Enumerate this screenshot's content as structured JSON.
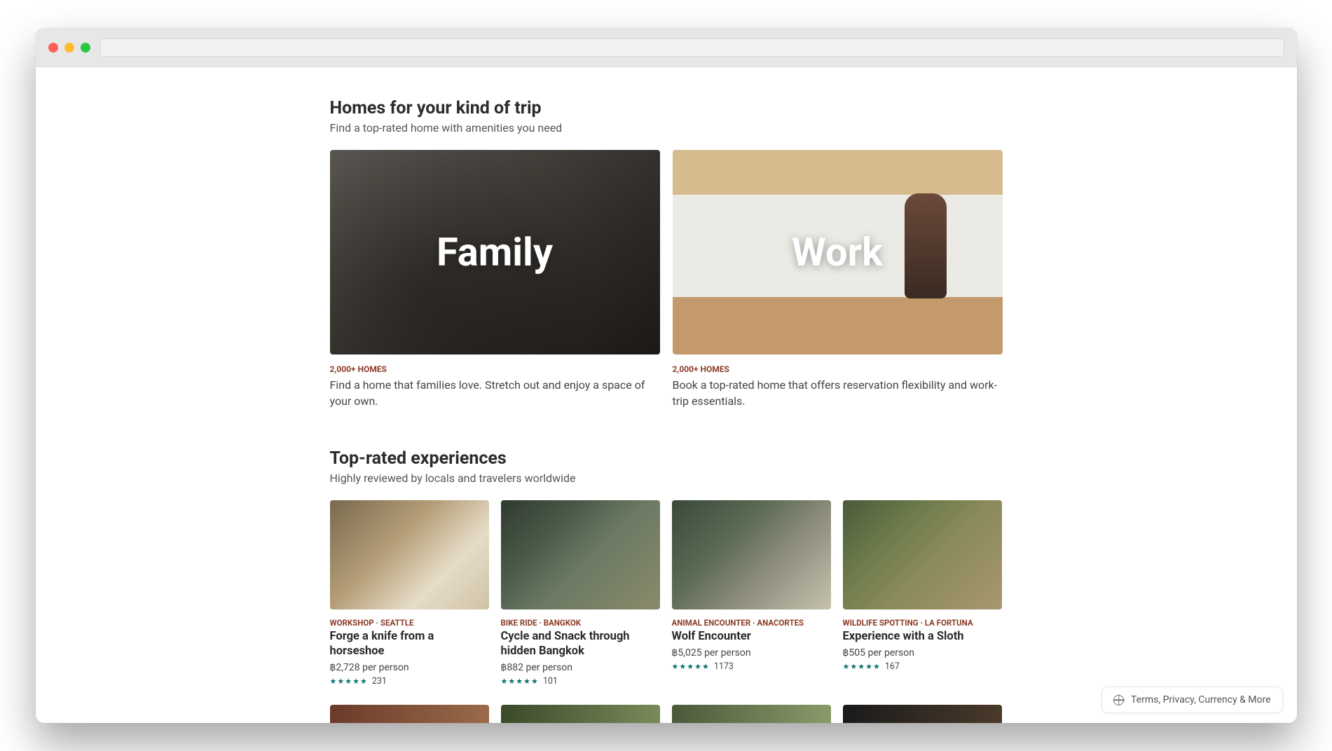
{
  "homes": {
    "title": "Homes for your kind of trip",
    "subtitle": "Find a top-rated home with amenities you need",
    "cards": [
      {
        "overlay": "Family",
        "tag": "2,000+ HOMES",
        "desc": "Find a home that families love. Stretch out and enjoy a space of your own."
      },
      {
        "overlay": "Work",
        "tag": "2,000+ HOMES",
        "desc": "Book a top-rated home that offers reservation flexibility and work-trip essentials."
      }
    ]
  },
  "experiences": {
    "title": "Top-rated experiences",
    "subtitle": "Highly reviewed by locals and travelers worldwide",
    "items": [
      {
        "category": "WORKSHOP · SEATTLE",
        "title": "Forge a knife from a horseshoe",
        "price": "฿2,728 per person",
        "reviews": "231"
      },
      {
        "category": "BIKE RIDE · BANGKOK",
        "title": "Cycle and Snack through hidden Bangkok",
        "price": "฿882 per person",
        "reviews": "101"
      },
      {
        "category": "ANIMAL ENCOUNTER · ANACORTES",
        "title": "Wolf Encounter",
        "price": "฿5,025 per person",
        "reviews": "1173"
      },
      {
        "category": "WILDLIFE SPOTTING · LA FORTUNA",
        "title": "Experience with a Sloth",
        "price": "฿505 per person",
        "reviews": "167"
      }
    ]
  },
  "footer": {
    "label": "Terms, Privacy, Currency & More"
  }
}
